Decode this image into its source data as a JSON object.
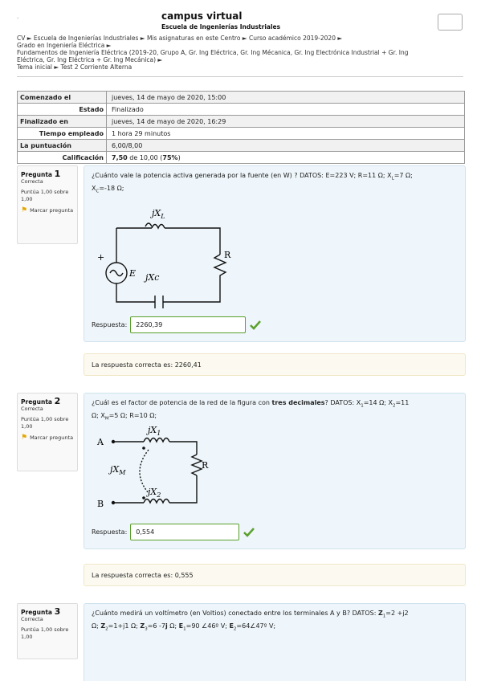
{
  "header": {
    "dot": ".",
    "title": "campus virtual",
    "subtitle": "Escuela de Ingenierías Industriales"
  },
  "breadcrumb": {
    "lines": [
      "CV ► Escuela de Ingenierías Industriales ► Mis asignaturas en este Centro ► Curso académico 2019-2020 ►",
      "Grado en Ingeniería Eléctrica ►",
      "Fundamentos de Ingeniería Eléctrica (2019-20, Grupo A, Gr. Ing Eléctrica, Gr. Ing Mécanica, Gr. Ing Electrónica Industrial + Gr. Ing",
      "Eléctrica, Gr. Ing Eléctrica + Gr. Ing Mecánica) ►",
      "Tema inicial ► Test 2 Corriente Alterna"
    ]
  },
  "summary": {
    "started_label": "Comenzado el",
    "started_value": "jueves, 14 de mayo de 2020, 15:00",
    "state_label": "Estado",
    "state_value": "Finalizado",
    "finished_label": "Finalizado en",
    "finished_value": "jueves, 14 de mayo de 2020, 16:29",
    "time_label": "Tiempo empleado",
    "time_value": "1 hora 29 minutos",
    "marks_label": "La puntuación",
    "marks_value": "6,00/8,00",
    "grade_label": "Calificación",
    "grade_value": "7,50",
    "grade_of": "de 10,00 (",
    "grade_percent": "75%",
    "grade_close": ")"
  },
  "questions": [
    {
      "label": "Pregunta",
      "number": "1",
      "state": "Correcta",
      "mark": "Puntúa 1,00 sobre 1,00",
      "flag": "Marcar pregunta",
      "text_1": "¿Cuánto vale la potencia activa generada por la fuente (en W) ? DATOS: E=223 V; R=11 Ω; X",
      "sub_l": "L",
      "text_2": "=7 Ω;",
      "sub_c": "C",
      "text_3": "=-18 Ω;",
      "answer_label": "Respuesta:",
      "answer_value": "2260,39",
      "feedback": "La respuesta correcta es: 2260,41",
      "circuit": {
        "top": "jX",
        "top_sub": "L",
        "bottom": "jXc",
        "right": "R",
        "source": "E",
        "plus": "+"
      }
    },
    {
      "label": "Pregunta",
      "number": "2",
      "state": "Correcta",
      "mark": "Puntúa 1,00 sobre 1,00",
      "flag": "Marcar pregunta",
      "text_1": "¿Cuál es el factor de potencia de la red de la figura con ",
      "text_bold": "tres decimales",
      "text_2": "? DATOS: X",
      "sub_1": "1",
      "text_3": "=14 Ω; X",
      "sub_2": "2",
      "text_4": "=11",
      "text_5": "Ω; X",
      "sub_m": "M",
      "text_6": "=5 Ω; R=10 Ω;",
      "answer_label": "Respuesta:",
      "answer_value": "0,554",
      "feedback": "La respuesta correcta es: 0,555",
      "circuit": {
        "a": "A",
        "b": "B",
        "x1": "jX",
        "x1_sub": "1",
        "x2": "jX",
        "x2_sub": "2",
        "xm": "jX",
        "xm_sub": "M",
        "right": "R"
      }
    },
    {
      "label": "Pregunta",
      "number": "3",
      "state": "Correcta",
      "mark": "Puntúa 1,00 sobre 1,00",
      "line1_a": "¿Cuánto medirá un voltímetro (en Voltios) conectado entre los terminales A y B?  DATOS: ",
      "z": "Z",
      "s1": "1",
      "line1_b": "=2 +j2",
      "line2_a": "Ω; ",
      "s2": "2",
      "line2_b": "=1+j1 Ω; ",
      "s3": "3",
      "line2_c": "=6  -7",
      "j": "j",
      "line2_d": " Ω; ",
      "e": "E",
      "line2_e": "=90 ∠46º V; ",
      "line2_f": "=64∠47º V;"
    }
  ],
  "colors": {
    "formulation_bg": "#eef6fb",
    "feedback_bg": "#fcfaf0",
    "correct": "#5aa02c",
    "flag": "#e3a700"
  },
  "icons": {
    "flag": "flag-icon",
    "check": "check-icon"
  }
}
